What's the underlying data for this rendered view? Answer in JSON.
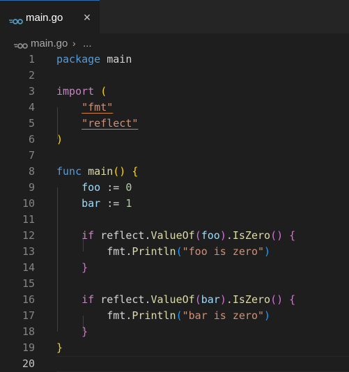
{
  "tab": {
    "label": "main.go",
    "close_glyph": "×",
    "icon": "go-icon"
  },
  "breadcrumb": {
    "file": "main.go",
    "separator": "›",
    "more": "..."
  },
  "editor": {
    "line_numbers": [
      "1",
      "2",
      "3",
      "4",
      "5",
      "6",
      "7",
      "8",
      "9",
      "10",
      "11",
      "12",
      "13",
      "14",
      "15",
      "16",
      "17",
      "18",
      "19",
      "20"
    ],
    "code": {
      "l1_kw": "package",
      "l1_name": "main",
      "l3_kw": "import",
      "l3_paren": "(",
      "l4_str": "\"fmt\"",
      "l5_str": "\"reflect\"",
      "l6_paren": ")",
      "l8_kw": "func",
      "l8_fn": "main",
      "l8_parens": "()",
      "l8_brace": "{",
      "l9_var": "foo",
      "l9_op": " := ",
      "l9_num": "0",
      "l10_var": "bar",
      "l10_op": " := ",
      "l10_num": "1",
      "l12_kw": "if",
      "l12_pkg": "reflect",
      "l12_fn1": "ValueOf",
      "l12_arg": "foo",
      "l12_fn2": "IsZero",
      "l12_brace": "{",
      "l13_pkg": "fmt",
      "l13_fn": "Println",
      "l13_str": "\"foo is zero\"",
      "l14_brace": "}",
      "l16_kw": "if",
      "l16_pkg": "reflect",
      "l16_fn1": "ValueOf",
      "l16_arg": "bar",
      "l16_fn2": "IsZero",
      "l16_brace": "{",
      "l17_pkg": "fmt",
      "l17_fn": "Println",
      "l17_str": "\"bar is zero\"",
      "l18_brace": "}",
      "l19_brace": "}"
    }
  },
  "colors": {
    "background": "#1e1e1e",
    "keyword": "#569cd6",
    "control": "#c586c0",
    "variable": "#9cdcfe",
    "function": "#dcdcaa",
    "number": "#b5cea8",
    "string": "#ce9178",
    "bracket_1": "#ffd700",
    "bracket_2": "#da70d6",
    "bracket_3": "#179fff"
  }
}
